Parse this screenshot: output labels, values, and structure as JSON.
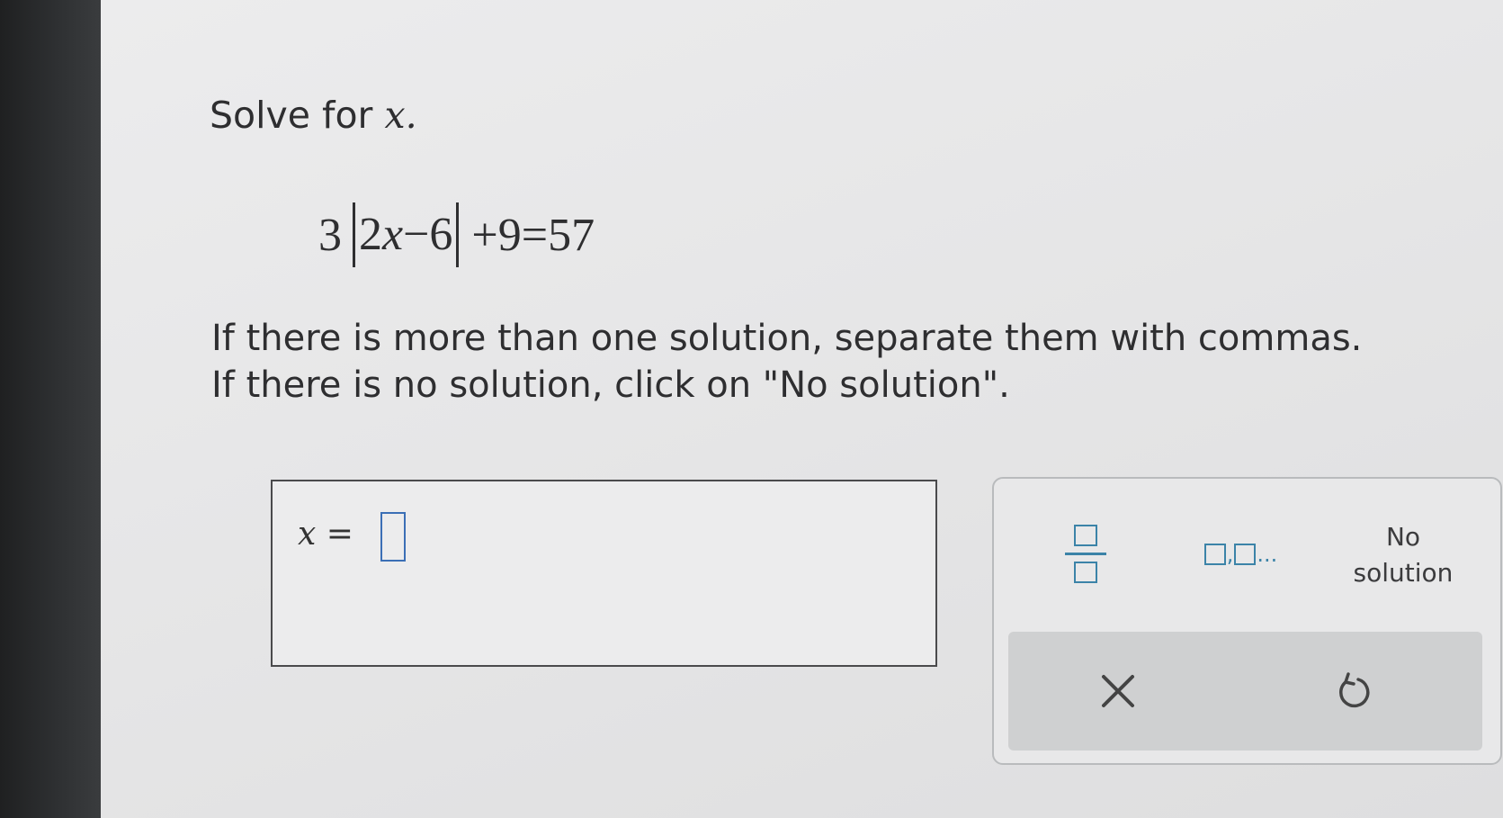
{
  "question": {
    "prompt_text": "Solve for",
    "prompt_var": "x.",
    "equation": {
      "coef": "3",
      "abs_inner_a": "2",
      "abs_inner_var": "x",
      "abs_inner_b": "−6",
      "rest": "+9=57"
    },
    "instruction_line1": "If there is more than one solution, separate them with commas.",
    "instruction_line2": "If there is no solution, click on \"No solution\"."
  },
  "answer": {
    "variable": "x",
    "equals": " =",
    "value": ""
  },
  "keypad": {
    "fraction_icon": "fraction-template-icon",
    "list_icon": "comma-list-template-icon",
    "list_ellipsis": "...",
    "no_solution_line1": "No",
    "no_solution_line2": "solution",
    "clear_icon": "close-icon",
    "undo_icon": "undo-icon"
  },
  "colors": {
    "accent": "#3b83a8",
    "input_border": "#3b6fb6",
    "text": "#2e2e30"
  }
}
